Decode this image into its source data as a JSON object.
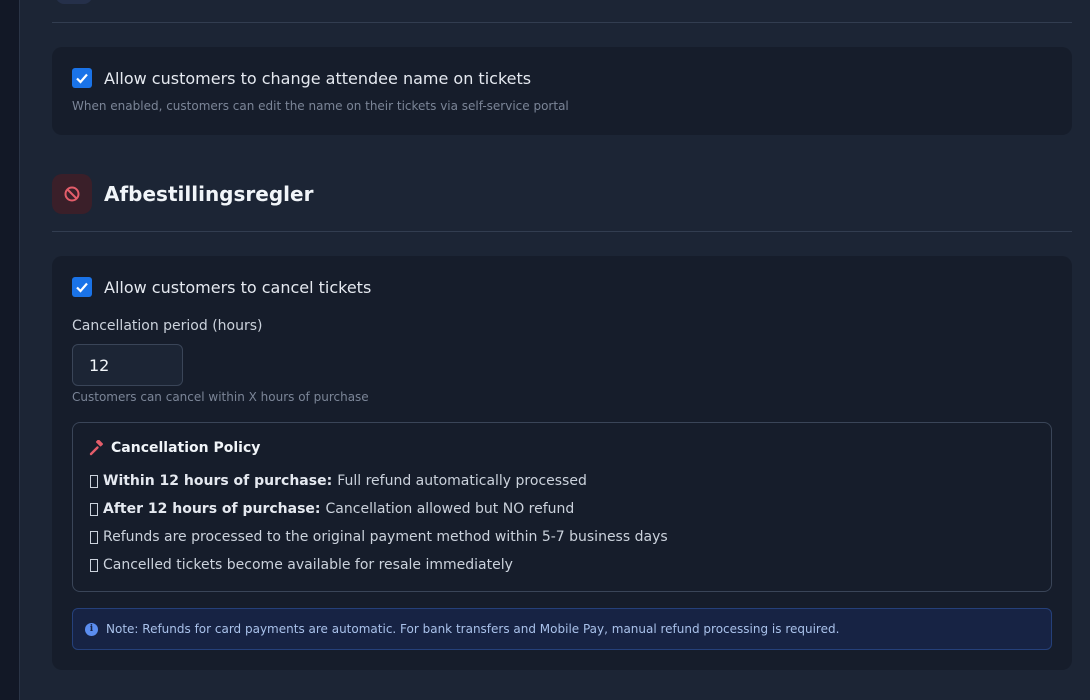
{
  "name_change": {
    "checked": true,
    "label": "Allow customers to change attendee name on tickets",
    "help": "When enabled, customers can edit the name on their tickets via self-service portal"
  },
  "cancellation_section": {
    "title": "Afbestillingsregler",
    "icon": "ban-icon",
    "accent_color": "#e35d6a"
  },
  "cancel": {
    "checked": true,
    "label": "Allow customers to cancel tickets",
    "period_label": "Cancellation period (hours)",
    "period_value": "12",
    "period_help": "Customers can cancel within X hours of purchase"
  },
  "policy": {
    "title": "Cancellation Policy",
    "icon": "gavel-icon",
    "items": [
      {
        "bold": "Within 12 hours of purchase:",
        "text": "Full refund automatically processed"
      },
      {
        "bold": "After 12 hours of purchase:",
        "text": "Cancellation allowed but NO refund"
      },
      {
        "bold": "",
        "text": "Refunds are processed to the original payment method within 5-7 business days"
      },
      {
        "bold": "",
        "text": "Cancelled tickets become available for resale immediately"
      }
    ]
  },
  "note": {
    "icon": "info-icon",
    "text": "Note: Refunds for card payments are automatic. For bank transfers and Mobile Pay, manual refund processing is required."
  },
  "colors": {
    "checkbox": "#1a73e8",
    "background": "#1c2535",
    "card": "#161d2b",
    "note_bg": "#172344"
  }
}
